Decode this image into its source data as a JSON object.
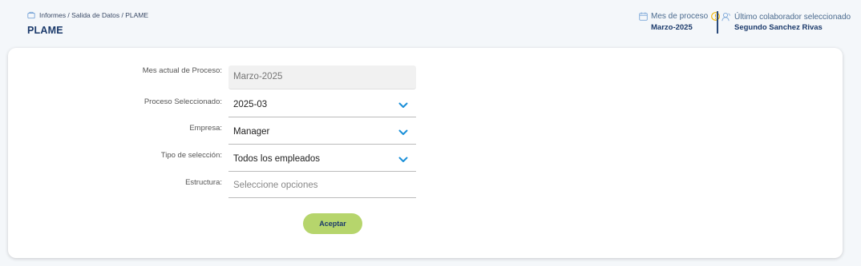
{
  "header": {
    "breadcrumb": "Informes / Salida de Datos / PLAME",
    "title": "PLAME",
    "process": {
      "label": "Mes de proceso",
      "value": "Marzo-2025"
    },
    "collaborator": {
      "label": "Último colaborador seleccionado",
      "value": "Segundo Sanchez Rivas"
    }
  },
  "form": {
    "mes_actual": {
      "label": "Mes actual de Proceso:",
      "value": "Marzo-2025"
    },
    "proceso": {
      "label": "Proceso Seleccionado:",
      "value": "2025-03"
    },
    "empresa": {
      "label": "Empresa:",
      "value": "Manager"
    },
    "tipo": {
      "label": "Tipo de selección:",
      "value": "Todos los empleados"
    },
    "estructura": {
      "label": "Estructura:",
      "placeholder": "Seleccione opciones"
    },
    "accept_label": "Aceptar"
  },
  "colors": {
    "accent": "#1b3a6b",
    "chevron": "#1a8fd8",
    "button": "#b6d56c",
    "info": "#f0b400"
  }
}
